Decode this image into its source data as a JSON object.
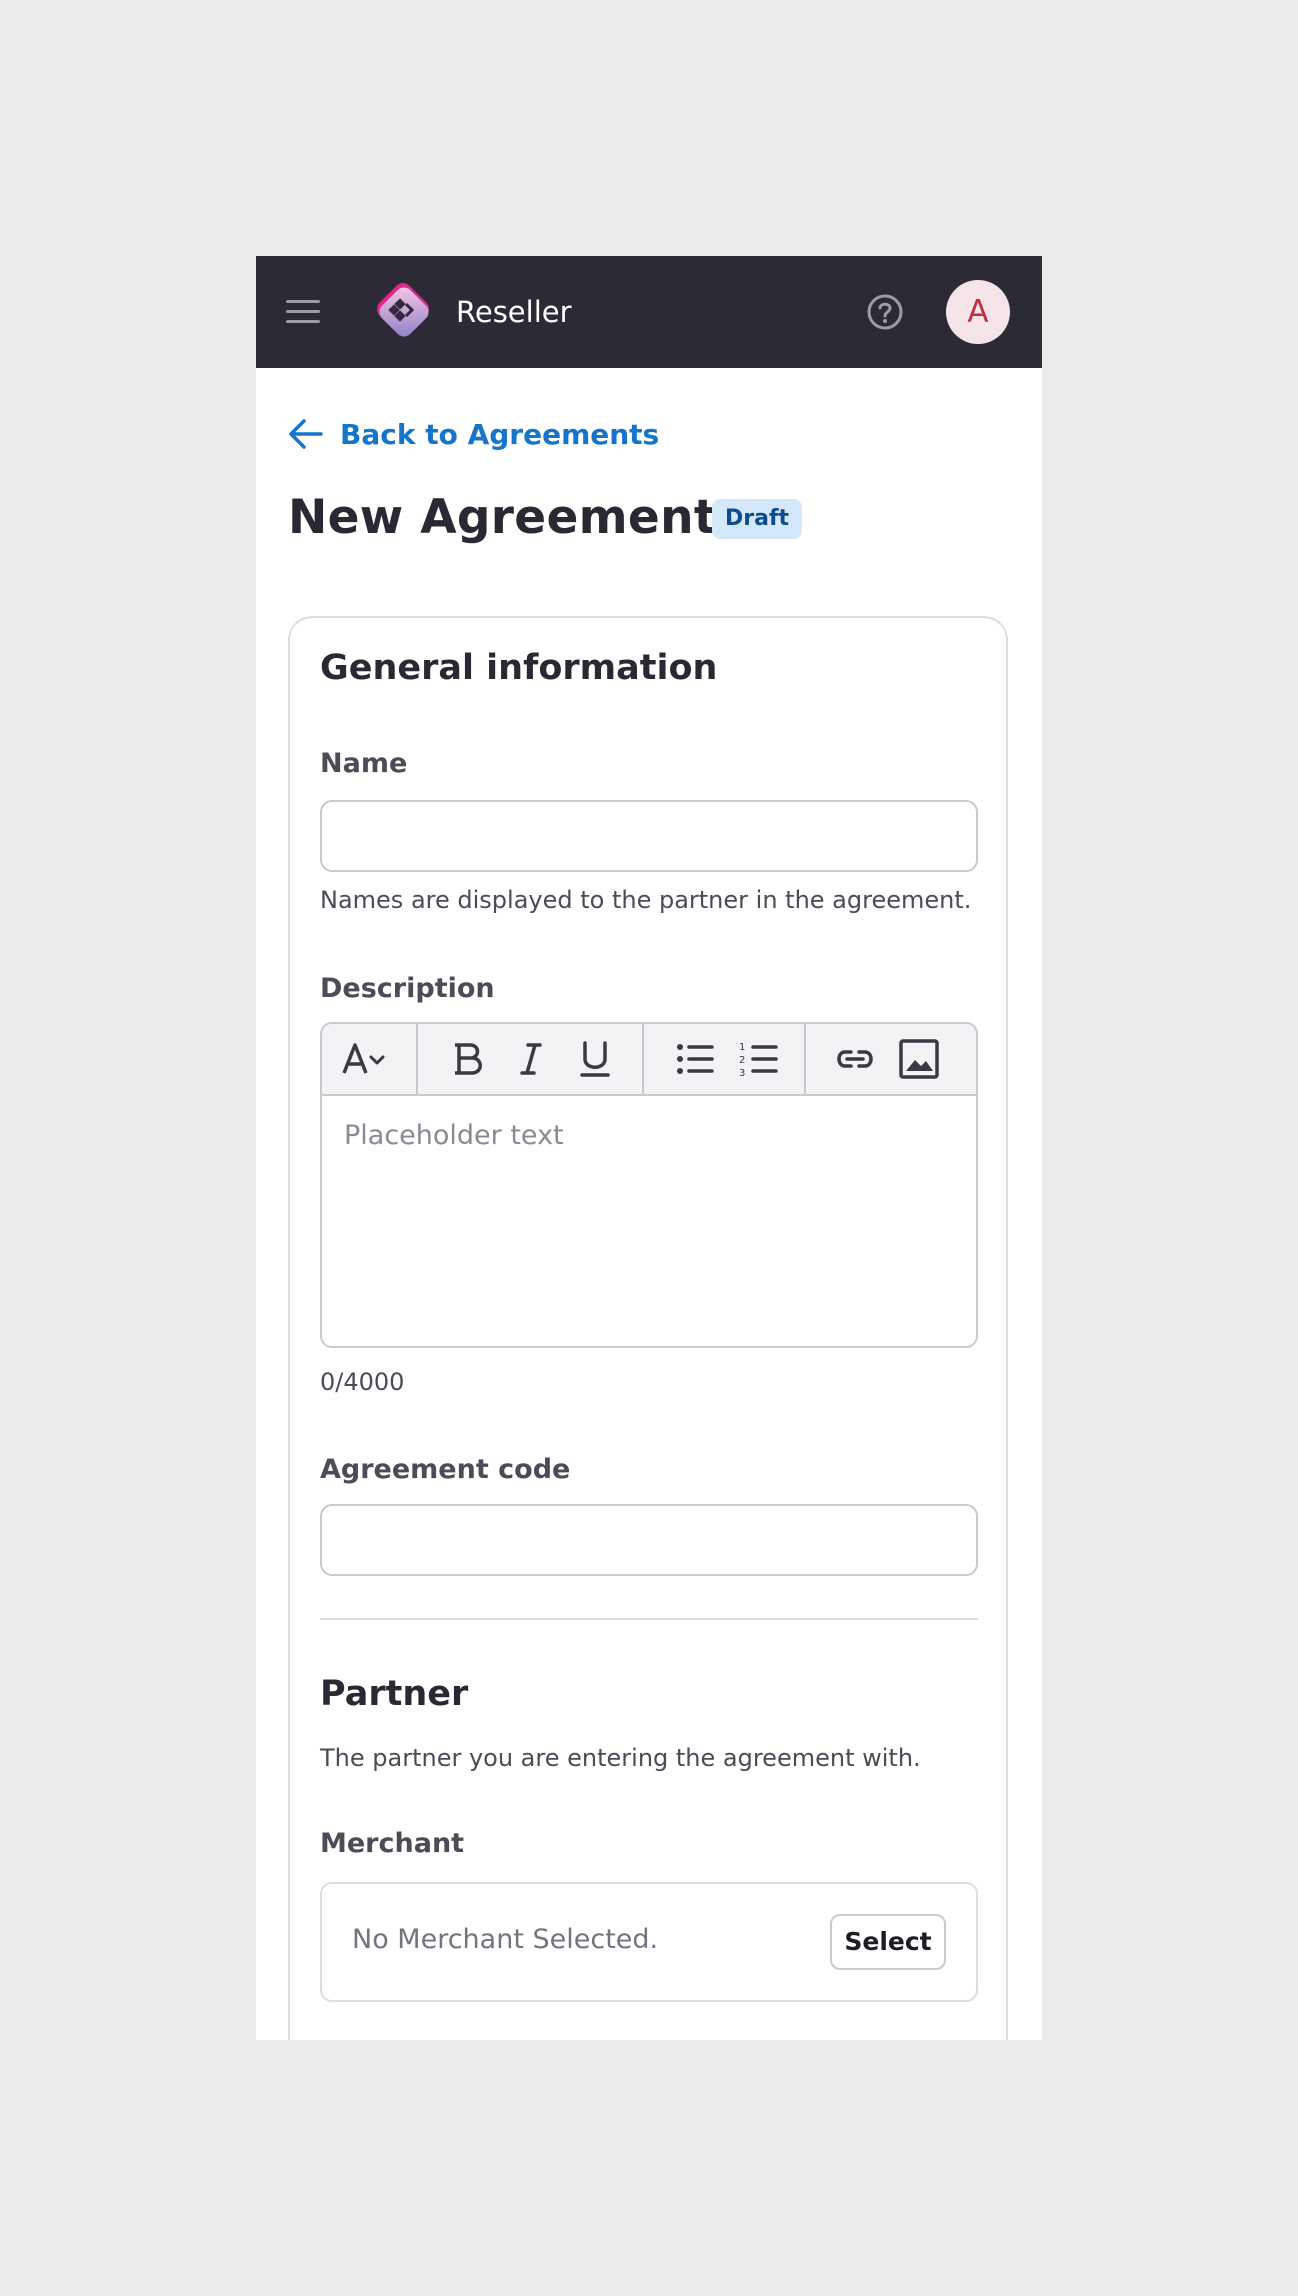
{
  "header": {
    "brand": "Reseller",
    "avatar_initial": "A",
    "icons": [
      "menu-icon",
      "reseller-logo",
      "help-icon"
    ]
  },
  "nav": {
    "back_label": "Back to Agreements"
  },
  "page": {
    "title": "New Agreement",
    "status_badge": "Draft"
  },
  "general": {
    "title": "General information",
    "name_label": "Name",
    "name_value": "",
    "name_helper": "Names are displayed to the partner in the agreement.",
    "description_label": "Description",
    "description_placeholder": "Placeholder text",
    "description_counter": "0/4000",
    "toolbar_icons": [
      "text-style-icon",
      "bold-icon",
      "italic-icon",
      "underline-icon",
      "bulleted-list-icon",
      "numbered-list-icon",
      "link-icon",
      "image-icon"
    ],
    "agreement_code_label": "Agreement code",
    "agreement_code_value": ""
  },
  "partner": {
    "title": "Partner",
    "subtitle": "The partner you are entering the agreement with.",
    "merchant_label": "Merchant",
    "merchant_empty": "No Merchant Selected.",
    "select_label": "Select"
  },
  "colors": {
    "topbar": "#2b2a35",
    "link": "#1475c9",
    "badge_bg": "#d4e8f9",
    "badge_text": "#0b4e8f",
    "avatar_bg": "#f6e5e8",
    "avatar_text": "#c42e43",
    "logo_pink": "#e0268f",
    "logo_purple": "#8a7bc4"
  }
}
